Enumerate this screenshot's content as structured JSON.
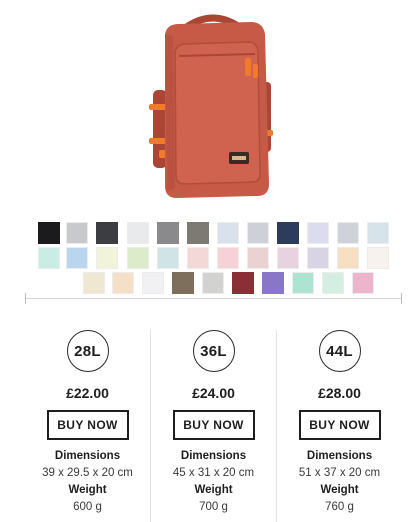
{
  "product": {
    "image_alt": "",
    "colors": {
      "body": "#c75a47",
      "body_dark": "#a94636",
      "accent": "#f07b2d"
    }
  },
  "swatches": [
    {
      "color": "#1b1b1e"
    },
    {
      "color": "#c8c9cc"
    },
    {
      "color": "#3c3d42"
    },
    {
      "color": "#e9eaec"
    },
    {
      "color": "#8a8a8d"
    },
    {
      "color": "#7c7a72"
    },
    {
      "color": "#d9e1ec"
    },
    {
      "color": "#cdd1d7"
    },
    {
      "color": "#2d3c5a"
    },
    {
      "color": "#dcdcef"
    },
    {
      "color": "#cfd2d8"
    },
    {
      "color": "#d6e3ea"
    },
    {
      "color": "#c9ece4"
    },
    {
      "color": "#b9d6ee"
    },
    {
      "color": "#f1f3da"
    },
    {
      "color": "#dcebc9"
    },
    {
      "color": "#d0e3e6"
    },
    {
      "color": "#f3d8d7"
    },
    {
      "color": "#f6d2d8"
    },
    {
      "color": "#ead1d2"
    },
    {
      "color": "#e7d3df"
    },
    {
      "color": "#d8d4e3"
    },
    {
      "color": "#f7e0c1"
    },
    {
      "color": "#f7f2ee"
    },
    {
      "color": "#f0e7d2"
    },
    {
      "color": "#f5dfc6"
    },
    {
      "color": "#f1f1f3"
    },
    {
      "color": "#7d6f5b"
    },
    {
      "color": "#d2d3d0"
    },
    {
      "color": "#8b2f36"
    },
    {
      "color": "#8a76c8"
    },
    {
      "color": "#aee3d1"
    },
    {
      "color": "#d5eee4"
    },
    {
      "color": "#ebb6cc"
    }
  ],
  "sizes": [
    {
      "size_label": "28L",
      "price": "£22.00",
      "buy_label": "BUY NOW",
      "dimensions_label": "Dimensions",
      "dimensions": "39 x 29.5 x 20 cm",
      "weight_label": "Weight",
      "weight": "600 g"
    },
    {
      "size_label": "36L",
      "price": "£24.00",
      "buy_label": "BUY NOW",
      "dimensions_label": "Dimensions",
      "dimensions": "45 x 31 x 20 cm",
      "weight_label": "Weight",
      "weight": "700 g"
    },
    {
      "size_label": "44L",
      "price": "£28.00",
      "buy_label": "BUY NOW",
      "dimensions_label": "Dimensions",
      "dimensions": "51 x 37 x 20 cm",
      "weight_label": "Weight",
      "weight": "760 g"
    }
  ]
}
